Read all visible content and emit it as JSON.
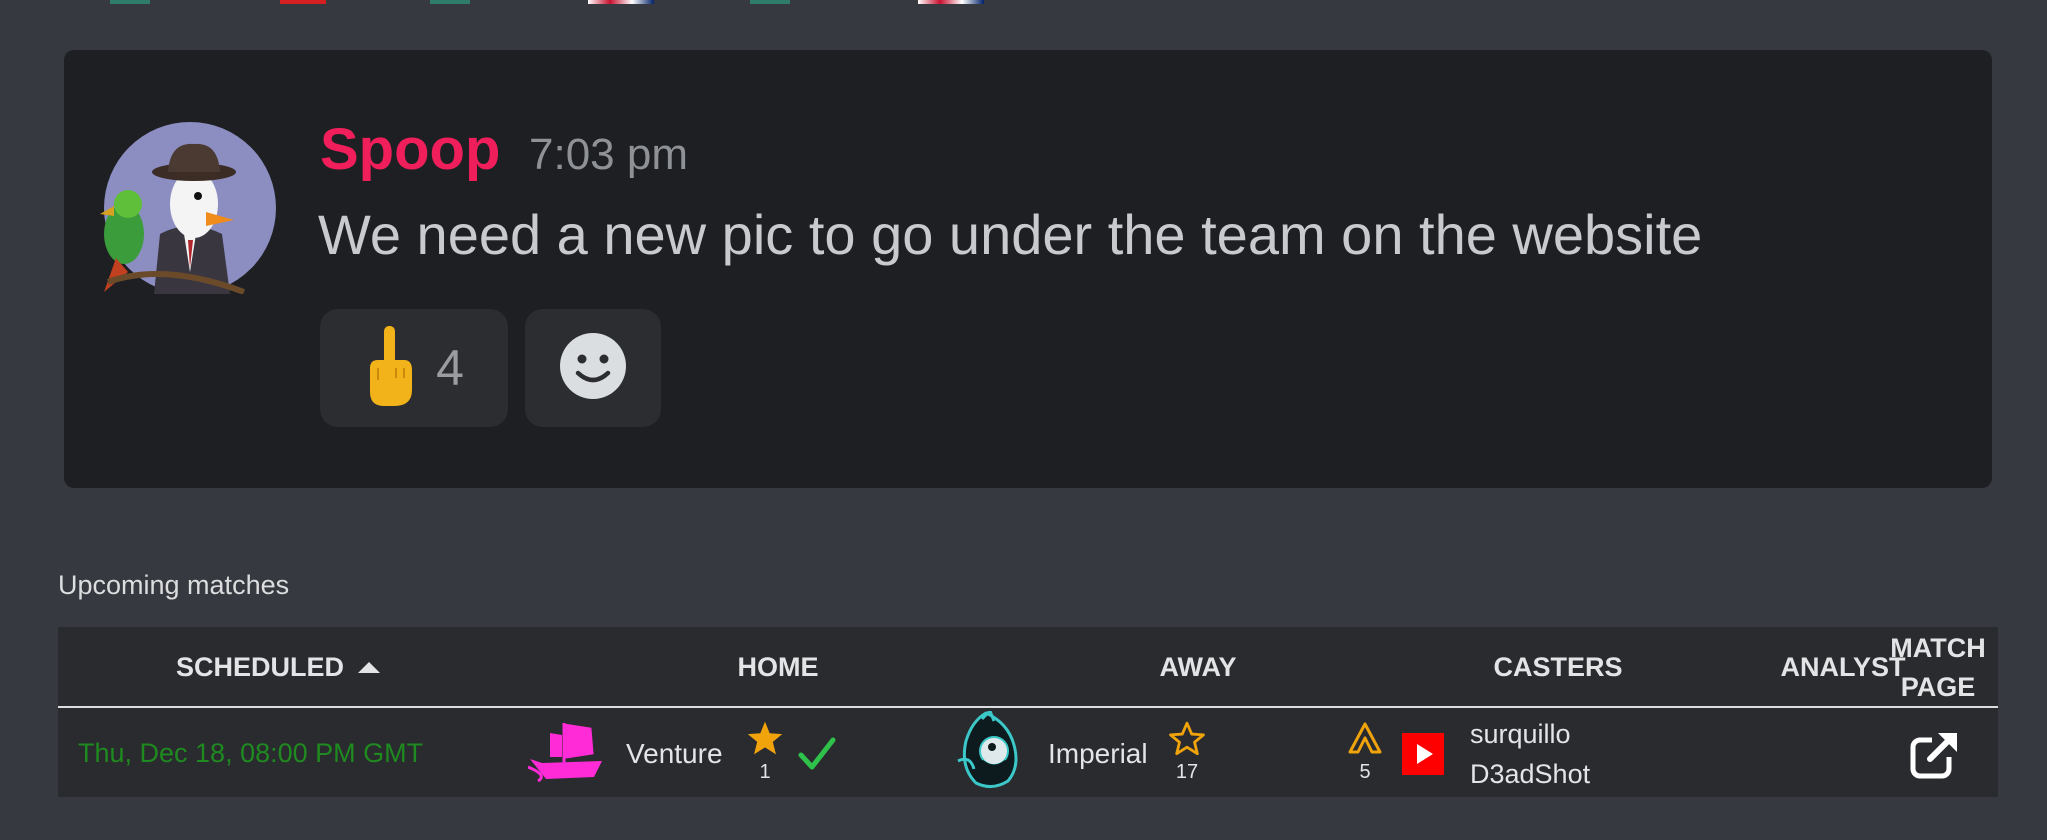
{
  "message": {
    "username": "Spoop",
    "time": "7:03 pm",
    "text": "We need a new pic to go under the team on the website",
    "reactions": [
      {
        "emoji_icon": "middle-finger-emoji-icon",
        "count": "4"
      },
      {
        "emoji_icon": "add-reaction-smiley-icon",
        "count": ""
      }
    ]
  },
  "matches": {
    "title": "Upcoming matches",
    "columns": {
      "scheduled": "SCHEDULED",
      "home": "HOME",
      "away": "AWAY",
      "casters": "CASTERS",
      "analyst": "ANALYST",
      "match_page": "MATCH PAGE"
    },
    "rows": [
      {
        "scheduled": "Thu, Dec 18, 08:00 PM GMT",
        "home": {
          "name": "Venture",
          "logo_icon": "pink-ship-logo-icon",
          "stars": "1",
          "confirmed": true
        },
        "away": {
          "name": "Imperial",
          "logo_icon": "imperial-mascot-logo-icon",
          "stars": "17"
        },
        "casters": {
          "rank_icon": "orange-chevron-rank-icon",
          "rank": "5",
          "platform_icon": "youtube-icon",
          "names": [
            "surquillo",
            "D3adShot"
          ]
        },
        "analyst": "",
        "match_page_icon": "external-link-icon"
      }
    ]
  },
  "colors": {
    "background": "#36393f",
    "card": "#1e1f22",
    "username": "#f01e5a",
    "date_green": "#1f8a1f",
    "star_orange": "#f0a30a",
    "check_green": "#2ec24a",
    "youtube_red": "#ff0000"
  }
}
